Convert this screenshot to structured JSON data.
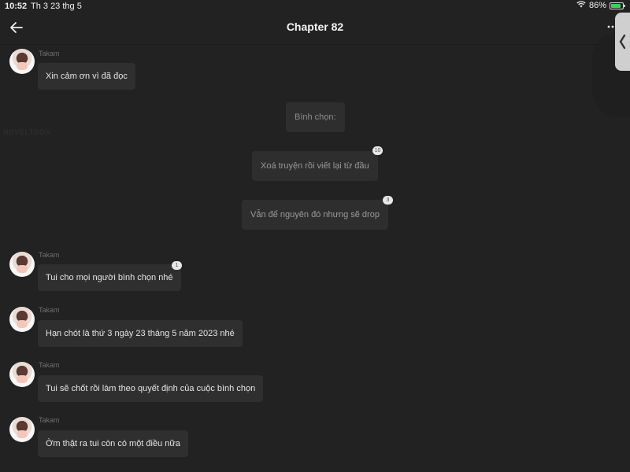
{
  "status_bar": {
    "time": "10:52",
    "date": "Th 3 23 thg 5",
    "battery_percent": "86%",
    "battery_level": 0.86,
    "battery_color": "#3ecf55"
  },
  "nav": {
    "title": "Chapter 82",
    "back_icon": "arrow-left-icon",
    "more_icon": "more-dots-icon"
  },
  "side_handle_icon": "chevron-left-icon",
  "watermark": "NOVELTOON",
  "messages": [
    {
      "author": "Takam",
      "text": "Xin cảm ơn vì đã đọc"
    },
    {
      "author": "Takam",
      "text": "Tui cho mọi người bình chọn nhé",
      "badge": "1"
    },
    {
      "author": "Takam",
      "text": "Hạn chót là thứ 3 ngày 23 tháng 5 năm 2023 nhé"
    },
    {
      "author": "Takam",
      "text": "Tui sẽ chốt rồi làm theo quyết định của cuộc bình chọn"
    },
    {
      "author": "Takam",
      "text": "Ờm thật ra tui còn có một điều nữa"
    }
  ],
  "poll": {
    "label": "Bình chọn:",
    "options": [
      {
        "text": "Xoá truyện rồi viết lại từ đầu",
        "votes": "10"
      },
      {
        "text": "Vẫn để nguyên đó nhưng sẽ drop",
        "votes": "3"
      }
    ]
  }
}
